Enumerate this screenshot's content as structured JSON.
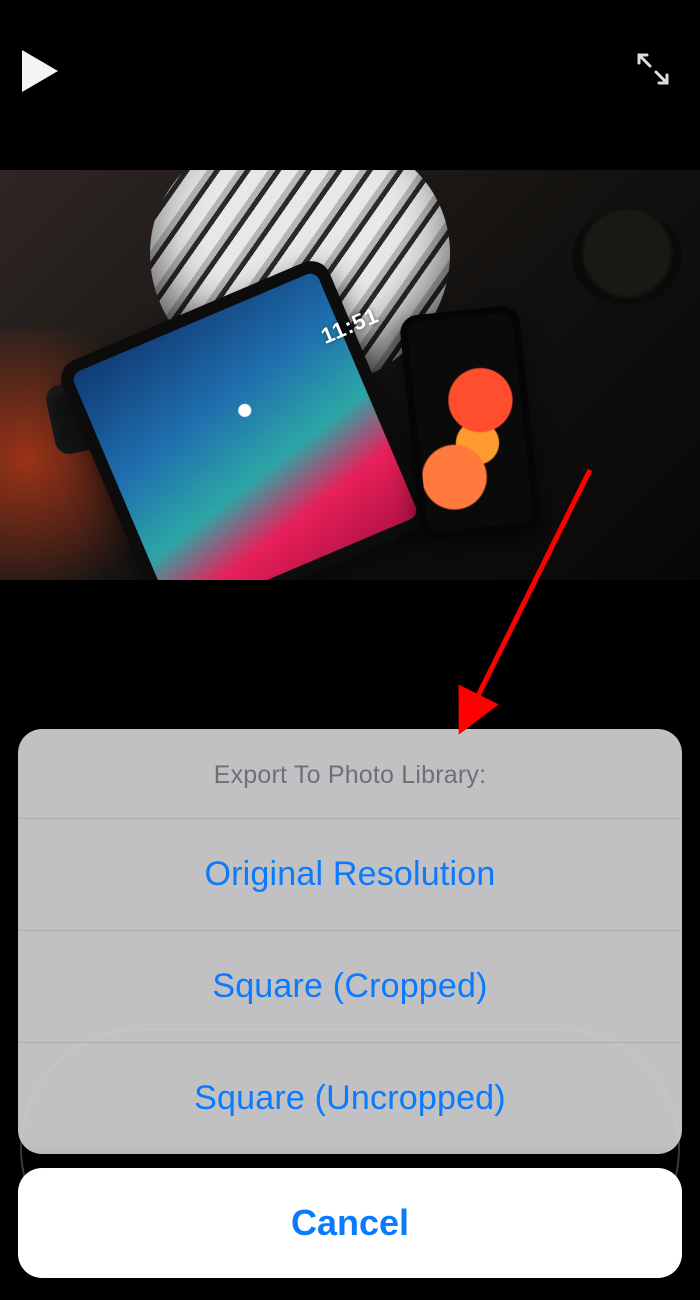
{
  "player": {
    "time_on_tablet": "11:51"
  },
  "sheet": {
    "title": "Export To Photo Library:",
    "options": [
      "Original Resolution",
      "Square (Cropped)",
      "Square (Uncropped)"
    ],
    "cancel": "Cancel"
  },
  "colors": {
    "ios_blue": "#0a7aff"
  },
  "annotation": {
    "description": "red arrow pointing to action sheet",
    "color": "#ff0000"
  }
}
